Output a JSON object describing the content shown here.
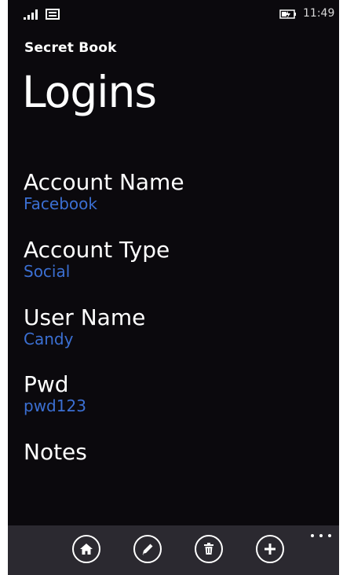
{
  "status_bar": {
    "time": "11:49",
    "icons": [
      "signal-icon",
      "message-icon",
      "battery-charging-icon"
    ]
  },
  "header": {
    "app_name": "Secret Book",
    "page_title": "Logins"
  },
  "fields": [
    {
      "label": "Account Name",
      "value": "Facebook"
    },
    {
      "label": "Account Type",
      "value": "Social"
    },
    {
      "label": "User Name",
      "value": "Candy"
    },
    {
      "label": "Pwd",
      "value": "pwd123"
    },
    {
      "label": "Notes",
      "value": ""
    }
  ],
  "app_bar": {
    "buttons": [
      "home-icon",
      "edit-icon",
      "delete-icon",
      "add-icon"
    ],
    "more": "more-icon"
  },
  "colors": {
    "background": "#0b090d",
    "accent": "#3b6fd2",
    "app_bar": "#2b2930",
    "text": "#ffffff"
  }
}
